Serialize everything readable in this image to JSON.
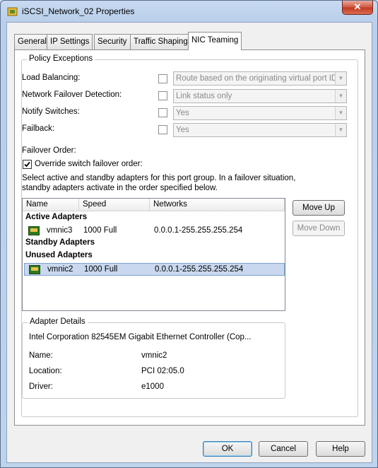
{
  "window": {
    "title": "iSCSI_Network_02 Properties",
    "close_label": "✕"
  },
  "tabs": [
    {
      "label": "General"
    },
    {
      "label": "IP Settings"
    },
    {
      "label": "Security"
    },
    {
      "label": "Traffic Shaping"
    },
    {
      "label": "NIC Teaming",
      "active": true
    }
  ],
  "policy": {
    "legend": "Policy Exceptions",
    "rows": [
      {
        "label": "Load Balancing:",
        "value": "Route based on the originating virtual port ID"
      },
      {
        "label": "Network Failover Detection:",
        "value": "Link status only"
      },
      {
        "label": "Notify Switches:",
        "value": "Yes"
      },
      {
        "label": "Failback:",
        "value": "Yes"
      }
    ],
    "failover_order_label": "Failover Order:",
    "override_label": "Override switch failover order:",
    "override_checked": true,
    "description": "Select active and standby adapters for this port group.  In a failover situation, standby adapters activate  in the order specified below."
  },
  "adapters": {
    "columns": [
      "Name",
      "Speed",
      "Networks"
    ],
    "groups": {
      "active": "Active Adapters",
      "standby": "Standby Adapters",
      "unused": "Unused Adapters"
    },
    "active_rows": [
      {
        "name": "vmnic3",
        "speed": "1000 Full",
        "networks": "0.0.0.1-255.255.255.254"
      }
    ],
    "unused_rows": [
      {
        "name": "vmnic2",
        "speed": "1000 Full",
        "networks": "0.0.0.1-255.255.255.254",
        "selected": true
      }
    ]
  },
  "buttons": {
    "move_up": "Move Up",
    "move_down": "Move Down",
    "ok": "OK",
    "cancel": "Cancel",
    "help": "Help"
  },
  "details": {
    "legend": "Adapter Details",
    "description": "Intel Corporation 82545EM Gigabit Ethernet Controller (Cop...",
    "name_label": "Name:",
    "name_value": "vmnic2",
    "location_label": "Location:",
    "location_value": "PCI 02:05.0",
    "driver_label": "Driver:",
    "driver_value": "e1000"
  }
}
